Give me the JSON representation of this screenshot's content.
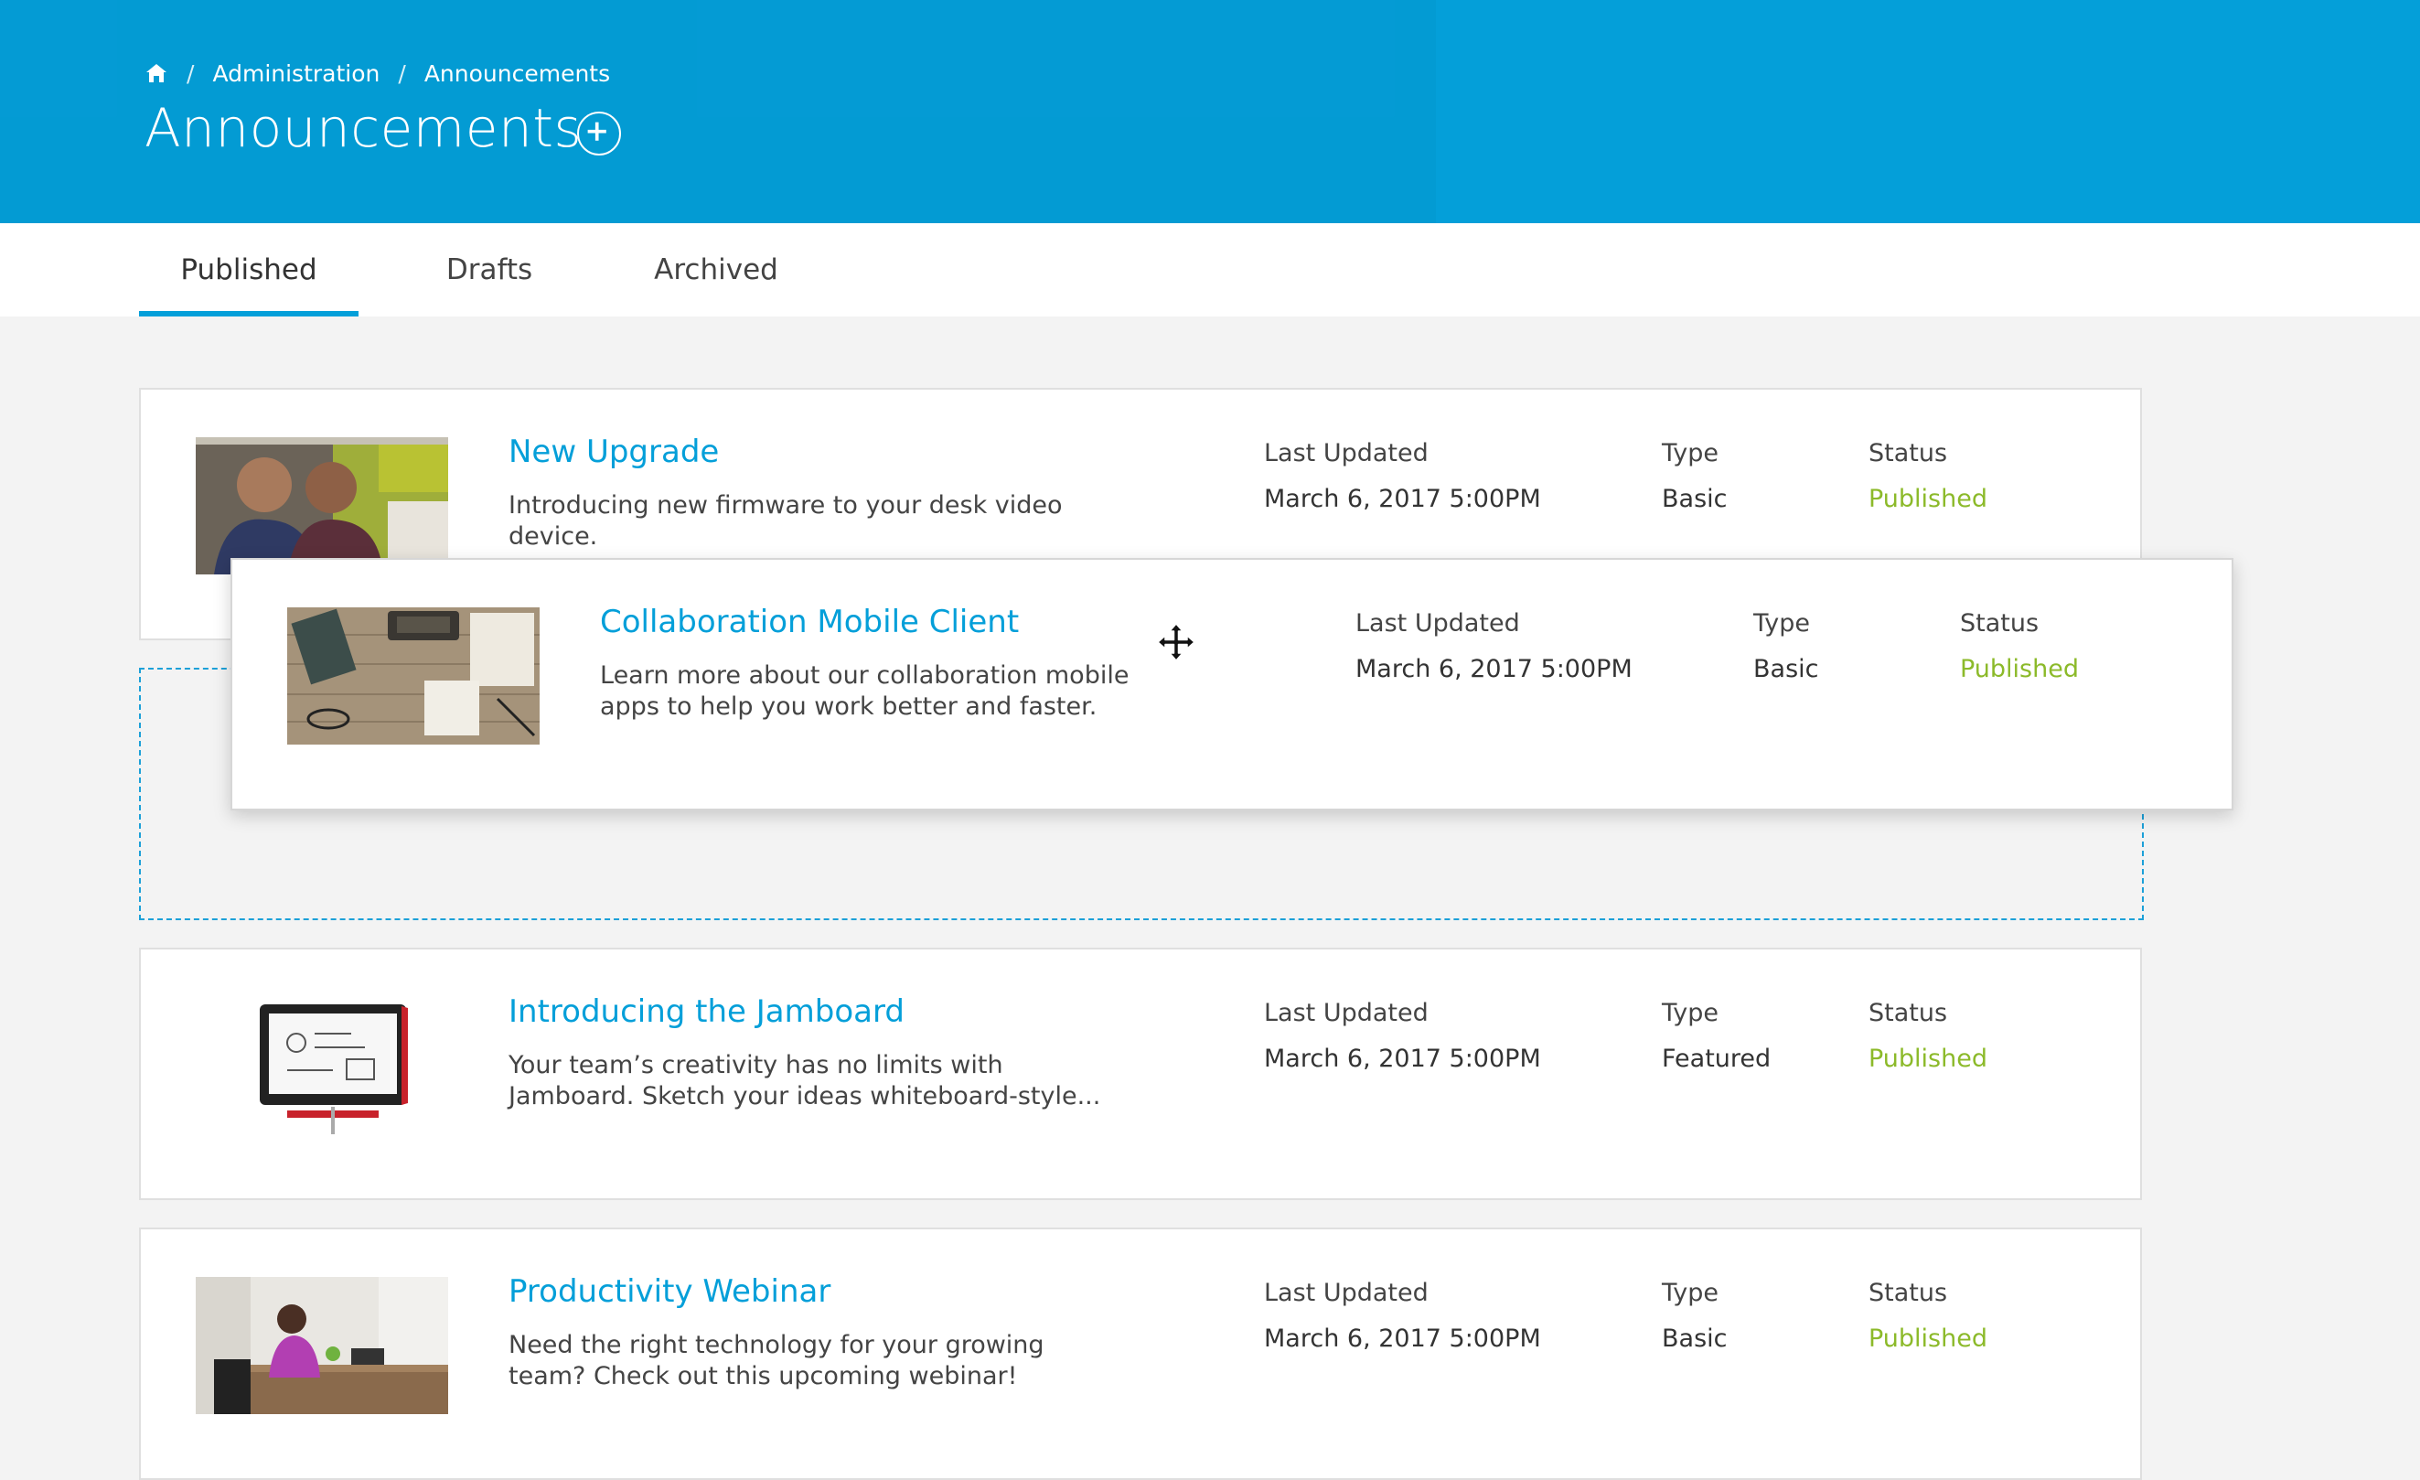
{
  "breadcrumb": {
    "home_icon": "home-icon",
    "items": [
      "Administration",
      "Announcements"
    ],
    "separator": "/"
  },
  "page": {
    "title": "Announcements",
    "add_icon": "plus-circle-icon"
  },
  "tabs": [
    {
      "label": "Published",
      "active": true
    },
    {
      "label": "Drafts",
      "active": false
    },
    {
      "label": "Archived",
      "active": false
    }
  ],
  "columns": {
    "updated": "Last Updated",
    "type": "Type",
    "status": "Status"
  },
  "announcements": [
    {
      "title": "New Upgrade",
      "description": "Introducing new firmware to your desk video device.",
      "last_updated": "March 6, 2017  5:00PM",
      "type": "Basic",
      "status": "Published"
    },
    {
      "title": "Collaboration Mobile Client",
      "description": "Learn more about our collaboration mobile apps to help you work better and faster.",
      "last_updated": "March 6, 2017  5:00PM",
      "type": "Basic",
      "status": "Published"
    },
    {
      "title": "Introducing the Jamboard",
      "description": "Your team’s creativity has no limits with Jamboard. Sketch your ideas whiteboard-style...",
      "last_updated": "March 6, 2017  5:00PM",
      "type": "Featured",
      "status": "Published"
    },
    {
      "title": "Productivity Webinar",
      "description": "Need the right technology for your growing team? Check out this upcoming webinar!",
      "last_updated": "March 6, 2017  5:00PM",
      "type": "Basic",
      "status": "Published"
    }
  ],
  "colors": {
    "brand": "#049fd9",
    "status_published": "#8cba2a"
  },
  "cursor_icon": "move-cursor-icon"
}
